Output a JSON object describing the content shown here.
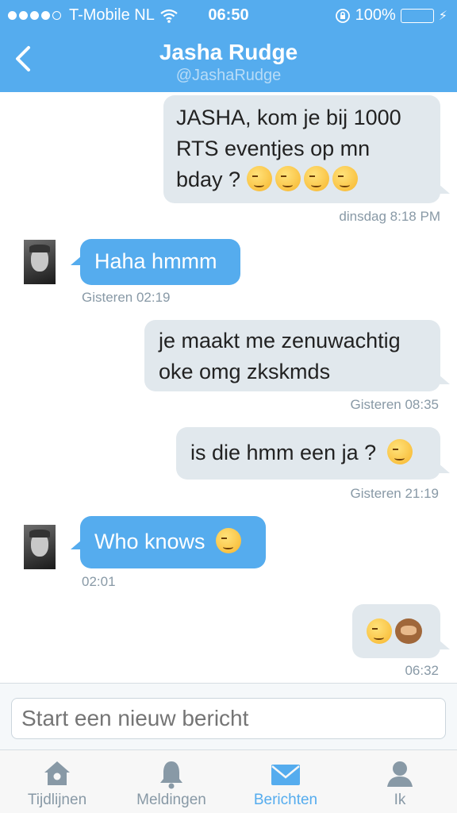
{
  "status_bar": {
    "carrier": "T-Mobile NL",
    "time": "06:50",
    "battery": "100%"
  },
  "header": {
    "name": "Jasha Rudge",
    "handle": "@JashaRudge"
  },
  "messages": [
    {
      "dir": "out",
      "lines": [
        "JASHA, kom je bij 1000",
        "RTS eventjes op mn",
        "bday ?"
      ],
      "time": "dinsdag 8:18 PM"
    },
    {
      "dir": "in",
      "text": "Haha hmmm",
      "time": "Gisteren 02:19"
    },
    {
      "dir": "out",
      "lines": [
        "je maakt me zenuwachtig",
        "oke omg zkskmds"
      ],
      "time": "Gisteren 08:35"
    },
    {
      "dir": "out",
      "text": "is die hmm een ja ?",
      "time": "Gisteren 21:19"
    },
    {
      "dir": "in",
      "text": "Who knows",
      "time": "02:01"
    },
    {
      "dir": "out",
      "text": "",
      "time": "06:32"
    }
  ],
  "composer": {
    "placeholder": "Start een nieuw bericht"
  },
  "tabs": [
    {
      "label": "Tijdlijnen",
      "icon": "home-icon"
    },
    {
      "label": "Meldingen",
      "icon": "bell-icon"
    },
    {
      "label": "Berichten",
      "icon": "envelope-icon",
      "active": true
    },
    {
      "label": "Ik",
      "icon": "person-icon"
    }
  ],
  "colors": {
    "accent": "#55acee",
    "bubble_out": "#e1e8ed",
    "timestamp": "#8899a6"
  }
}
